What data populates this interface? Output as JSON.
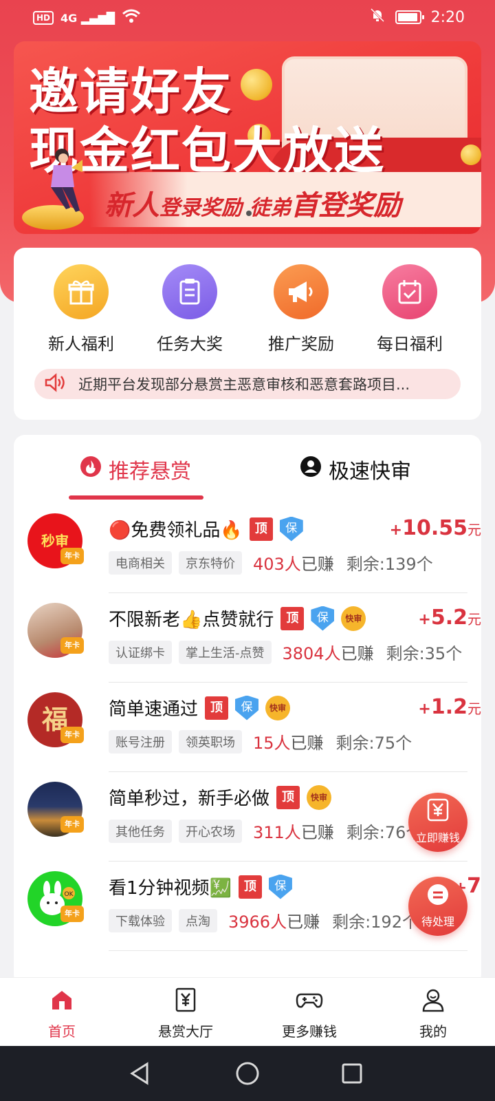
{
  "status_bar": {
    "hd": "HD",
    "signal": "4G",
    "time": "2:20"
  },
  "banner": {
    "title_line1": "邀请好友",
    "title_line2": "现金红包大放送",
    "sub_a_big": "新人",
    "sub_a_small": "登录奖励",
    "sub_b_small": "徒弟",
    "sub_b_big": "首登奖励"
  },
  "quick_menu": [
    {
      "label": "新人福利",
      "icon": "gift-icon",
      "color": "#f7b733"
    },
    {
      "label": "任务大奖",
      "icon": "clipboard-icon",
      "color": "#8d6bf0"
    },
    {
      "label": "推广奖励",
      "icon": "megaphone-icon",
      "color": "#f4813a"
    },
    {
      "label": "每日福利",
      "icon": "calendar-check-icon",
      "color": "#ef4f7a"
    }
  ],
  "notice": {
    "text": "近期平台发现部分悬赏主恶意审核和恶意套路项目..."
  },
  "tabs": [
    {
      "label": "推荐悬赏",
      "active": true
    },
    {
      "label": "极速快审",
      "active": false
    }
  ],
  "tasks": [
    {
      "avatar_text": "秒审",
      "badge": "年卡",
      "title": "🔴免费领礼品🔥",
      "top": "顶",
      "shield": "保",
      "fast": "",
      "chips": [
        "电商相关",
        "京东特价"
      ],
      "earned_num": "403人",
      "earned_suffix": "已赚",
      "remaining": "剩余:139个",
      "price_plus": "+",
      "price_amount": "10.55",
      "price_unit": "元"
    },
    {
      "avatar_text": "",
      "badge": "年卡",
      "title": "不限新老👍点赞就行",
      "top": "顶",
      "shield": "保",
      "fast": "快审",
      "chips": [
        "认证绑卡",
        "掌上生活-点赞"
      ],
      "earned_num": "3804人",
      "earned_suffix": "已赚",
      "remaining": "剩余:35个",
      "price_plus": "+",
      "price_amount": "5.2",
      "price_unit": "元"
    },
    {
      "avatar_text": "福",
      "badge": "年卡",
      "title": "简单速通过",
      "top": "顶",
      "shield": "保",
      "fast": "快审",
      "chips": [
        "账号注册",
        "领英职场"
      ],
      "earned_num": "15人",
      "earned_suffix": "已赚",
      "remaining": "剩余:75个",
      "price_plus": "+",
      "price_amount": "1.2",
      "price_unit": "元"
    },
    {
      "avatar_text": "",
      "badge": "年卡",
      "title": "简单秒过，新手必做",
      "top": "顶",
      "shield": "",
      "fast": "快审",
      "chips": [
        "其他任务",
        "开心农场"
      ],
      "earned_num": "311人",
      "earned_suffix": "已赚",
      "remaining": "剩余:76个",
      "price_plus": "",
      "price_amount": "",
      "price_unit": ""
    },
    {
      "avatar_text": "OK",
      "badge": "年卡",
      "title": "看1分钟视频💹",
      "top": "顶",
      "shield": "保",
      "fast": "",
      "chips": [
        "下载体验",
        "点淘"
      ],
      "earned_num": "3966人",
      "earned_suffix": "已赚",
      "remaining": "剩余:192个",
      "price_plus": "+",
      "price_amount": "7",
      "price_unit": ""
    }
  ],
  "float_buttons": {
    "earn": {
      "label": "立即赚钱",
      "icon": "yen-icon"
    },
    "pending": {
      "label": "待处理",
      "icon": "chat-icon"
    }
  },
  "bottom_nav": [
    {
      "label": "首页",
      "icon": "home-icon",
      "active": true
    },
    {
      "label": "悬赏大厅",
      "icon": "yen-receipt-icon",
      "active": false
    },
    {
      "label": "更多赚钱",
      "icon": "gamepad-icon",
      "active": false
    },
    {
      "label": "我的",
      "icon": "user-icon",
      "active": false
    }
  ],
  "colors": {
    "primary": "#e0354a",
    "header_red": "#e9434f",
    "price_red": "#d9333f"
  }
}
